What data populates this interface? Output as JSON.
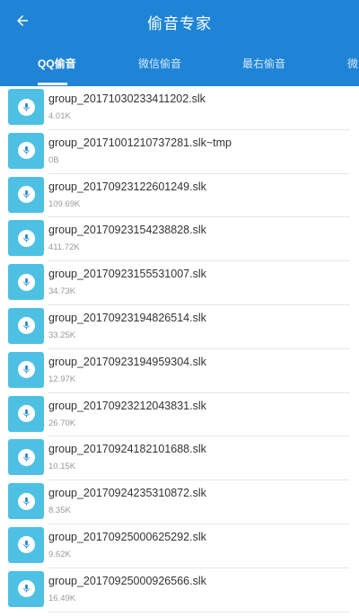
{
  "header": {
    "title": "偷音专家"
  },
  "tabs": [
    {
      "label": "QQ偷音",
      "active": true
    },
    {
      "label": "微信偷音",
      "active": false
    },
    {
      "label": "最右偷音",
      "active": false
    },
    {
      "label": "微",
      "active": false
    }
  ],
  "colors": {
    "primary": "#1f84d6",
    "thumb": "#4ec0e4",
    "mic": "#1f84d6"
  },
  "icons": {
    "back": "arrow-left-icon",
    "file": "microphone-icon"
  },
  "files": [
    {
      "name": "group_20171030233411202.slk",
      "size": "4.01K"
    },
    {
      "name": "group_20171001210737281.slk~tmp",
      "size": "0B"
    },
    {
      "name": "group_20170923122601249.slk",
      "size": "109.69K"
    },
    {
      "name": "group_20170923154238828.slk",
      "size": "411.72K"
    },
    {
      "name": "group_20170923155531007.slk",
      "size": "34.73K"
    },
    {
      "name": "group_20170923194826514.slk",
      "size": "33.25K"
    },
    {
      "name": "group_20170923194959304.slk",
      "size": "12.97K"
    },
    {
      "name": "group_20170923212043831.slk",
      "size": "26.70K"
    },
    {
      "name": "group_20170924182101688.slk",
      "size": "10.15K"
    },
    {
      "name": "group_20170924235310872.slk",
      "size": "8.35K"
    },
    {
      "name": "group_20170925000625292.slk",
      "size": "9.62K"
    },
    {
      "name": "group_20170925000926566.slk",
      "size": "16.49K"
    }
  ]
}
